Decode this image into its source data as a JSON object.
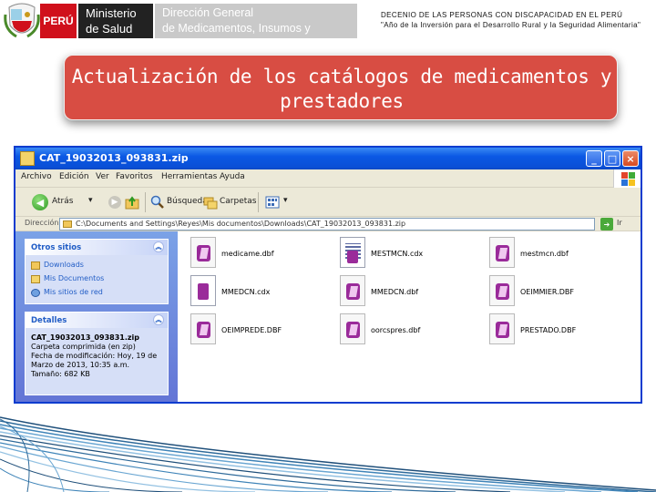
{
  "header": {
    "peru_label": "PERÚ",
    "ministerio_line1": "Ministerio",
    "ministerio_line2": "de Salud",
    "dg_line1": "Dirección General",
    "dg_line2": "de Medicamentos, Insumos y Drogas",
    "decenio_line1": "DECENIO DE LAS PERSONAS CON DISCAPACIDAD EN EL PERÚ",
    "decenio_line2": "\"Año de la Inversión para el Desarrollo Rural y la Seguridad Alimentaria\""
  },
  "slide_title": {
    "line1": "Actualización de los catálogos de medicamentos y",
    "line2": "prestadores"
  },
  "window": {
    "title": "CAT_19032013_093831.zip",
    "minimize": "_",
    "maximize": "□",
    "close": "×",
    "menu": [
      "Archivo",
      "Edición",
      "Ver",
      "Favoritos",
      "Herramientas",
      "Ayuda"
    ],
    "toolbar": {
      "back_label": "Atrás",
      "search_label": "Búsqueda",
      "folders_label": "Carpetas"
    },
    "address": {
      "label": "Dirección",
      "path": "C:\\Documents and Settings\\Reyes\\Mis documentos\\Downloads\\CAT_19032013_093831.zip",
      "go_label": "Ir"
    },
    "other_places": {
      "title": "Otros sitios",
      "items": [
        "Downloads",
        "Mis Documentos",
        "Mis sitios de red"
      ]
    },
    "details": {
      "title": "Detalles",
      "name": "CAT_19032013_093831.zip",
      "type": "Carpeta comprimida (en zip)",
      "modified_1": "Fecha de modificación: Hoy, 19 de",
      "modified_2": "Marzo de 2013, 10:35 a.m.",
      "size": "Tamaño: 682 KB"
    },
    "files": [
      {
        "name": "medicame.dbf",
        "kind": "dbf"
      },
      {
        "name": "MESTMCN.cdx",
        "kind": "cdx"
      },
      {
        "name": "mestmcn.dbf",
        "kind": "dbf"
      },
      {
        "name": "MMEDCN.cdx",
        "kind": "cdx"
      },
      {
        "name": "MMEDCN.dbf",
        "kind": "dbf"
      },
      {
        "name": "OEIMMIER.DBF",
        "kind": "dbf"
      },
      {
        "name": "OEIMPREDE.DBF",
        "kind": "dbf"
      },
      {
        "name": "oorcspres.dbf",
        "kind": "dbf"
      },
      {
        "name": "PRESTADO.DBF",
        "kind": "dbf"
      }
    ]
  },
  "colors": {
    "title_bg": "#d84d43",
    "xp_blue": "#0a4fd6",
    "peru_red": "#d0101b"
  }
}
